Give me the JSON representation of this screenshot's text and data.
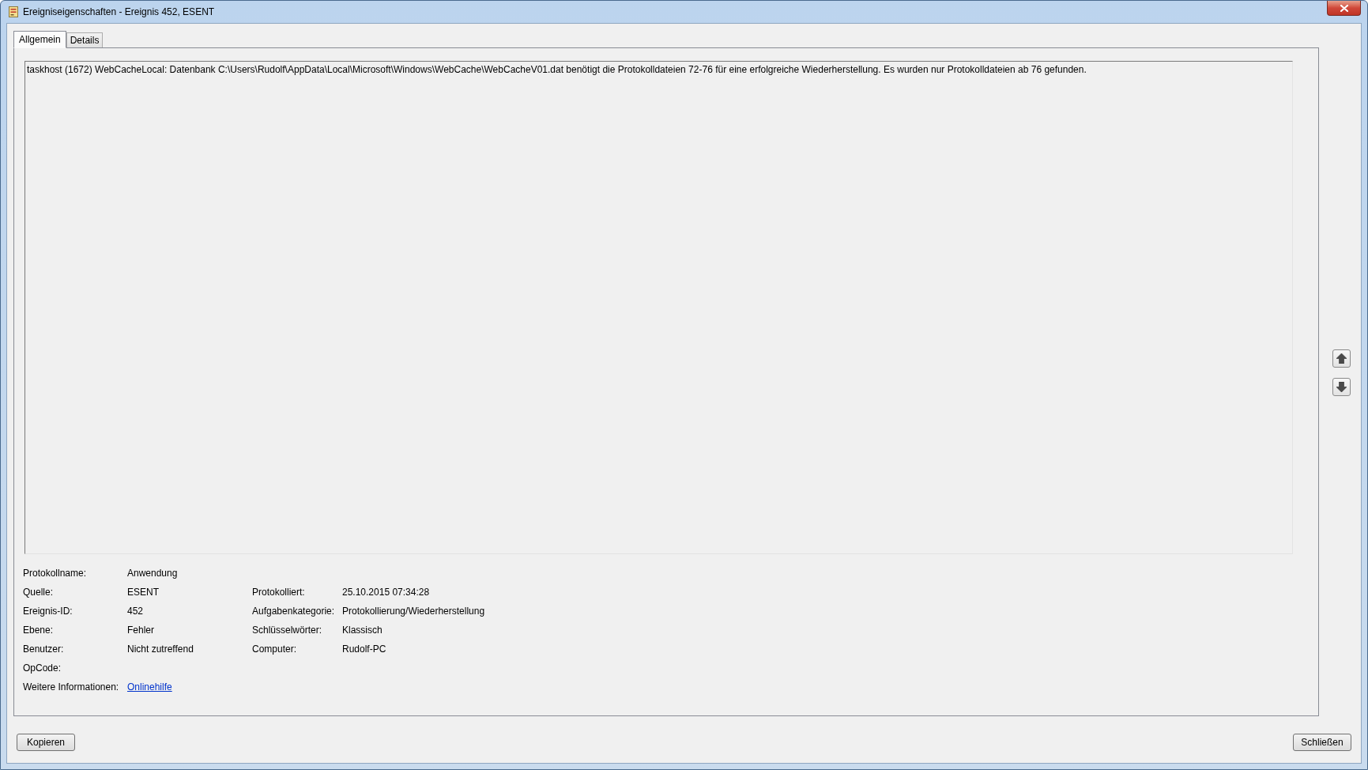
{
  "window": {
    "title": "Ereigniseigenschaften - Ereignis 452, ESENT"
  },
  "tabs": [
    {
      "label": "Allgemein",
      "selected": true
    },
    {
      "label": "Details",
      "selected": false
    }
  ],
  "message": "taskhost (1672) WebCacheLocal: Datenbank C:\\Users\\Rudolf\\AppData\\Local\\Microsoft\\Windows\\WebCache\\WebCacheV01.dat benötigt die Protokolldateien 72-76 für eine erfolgreiche Wiederherstellung. Es wurden nur Protokolldateien ab 76 gefunden.",
  "details": {
    "rows": [
      [
        {
          "label": "Protokollname:",
          "value": "Anwendung"
        }
      ],
      [
        {
          "label": "Quelle:",
          "value": "ESENT"
        },
        {
          "label": "Protokolliert:",
          "value": "25.10.2015 07:34:28"
        }
      ],
      [
        {
          "label": "Ereignis-ID:",
          "value": "452"
        },
        {
          "label": "Aufgabenkategorie:",
          "value": "Protokollierung/Wiederherstellung"
        }
      ],
      [
        {
          "label": "Ebene:",
          "value": "Fehler"
        },
        {
          "label": "Schlüsselwörter:",
          "value": "Klassisch"
        }
      ],
      [
        {
          "label": "Benutzer:",
          "value": "Nicht zutreffend"
        },
        {
          "label": "Computer:",
          "value": "Rudolf-PC"
        }
      ],
      [
        {
          "label": "OpCode:"
        }
      ],
      [
        {
          "label": "Weitere Informationen:",
          "link": "Onlinehilfe"
        }
      ]
    ]
  },
  "buttons": [
    {
      "label": "Kopieren"
    },
    {
      "label": "Schließen"
    }
  ]
}
